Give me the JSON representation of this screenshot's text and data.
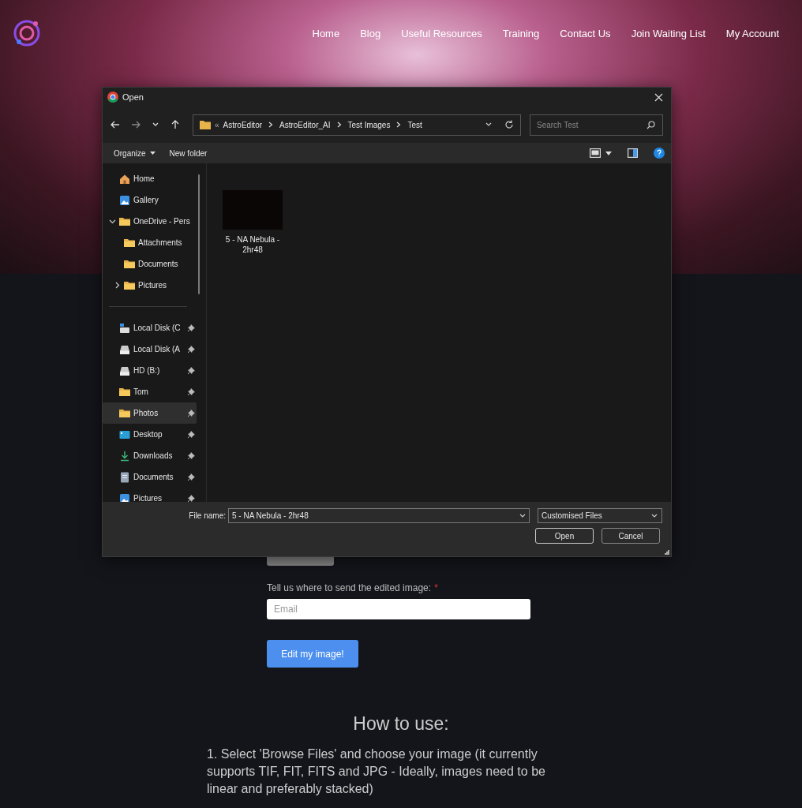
{
  "header": {
    "nav": [
      "Home",
      "Blog",
      "Useful Resources",
      "Training",
      "Contact Us",
      "Join Waiting List",
      "My Account"
    ]
  },
  "form": {
    "email_label": "Tell us where to send the edited image:",
    "required_mark": "*",
    "email": {
      "placeholder": "Email"
    },
    "submit": "Edit my image!"
  },
  "how_to": {
    "title": "How to use:",
    "steps": [
      "1. Select 'Browse Files' and choose your image (it currently supports TIF, FIT, FITS and JPG - Ideally, images need to be linear and preferably stacked)"
    ]
  },
  "dialog": {
    "title": "Open",
    "overflow": "«",
    "breadcrumb": [
      "AstroEditor",
      "AstroEditor_AI",
      "Test Images",
      "Test"
    ],
    "search": {
      "placeholder": "Search Test"
    },
    "commands": [
      {
        "label": "Organize",
        "kind": "menu"
      },
      {
        "label": "New folder",
        "kind": "plain"
      }
    ],
    "tree": [
      {
        "label": "Home",
        "kind": "home"
      },
      {
        "label": "Gallery",
        "kind": "gallery"
      },
      {
        "label": "OneDrive - Pers",
        "kind": "folder",
        "expanded": true,
        "children": [
          {
            "label": "Attachments",
            "kind": "folder"
          },
          {
            "label": "Documents",
            "kind": "folder"
          },
          {
            "label": "Pictures",
            "kind": "folder",
            "expanded": false
          }
        ]
      }
    ],
    "quick_access": [
      {
        "label": "Local Disk (C",
        "kind": "system-drive",
        "pinned": true,
        "selected": false
      },
      {
        "label": "Local Disk (A",
        "kind": "drive",
        "pinned": true,
        "selected": false
      },
      {
        "label": "HD (B:)",
        "kind": "drive",
        "pinned": true,
        "selected": false
      },
      {
        "label": "Tom",
        "kind": "folder",
        "pinned": true,
        "selected": false
      },
      {
        "label": "Photos",
        "kind": "folder",
        "pinned": true,
        "selected": true
      },
      {
        "label": "Desktop",
        "kind": "desktop",
        "pinned": true,
        "selected": false
      },
      {
        "label": "Downloads",
        "kind": "download",
        "pinned": true,
        "selected": false
      },
      {
        "label": "Documents",
        "kind": "document",
        "pinned": true,
        "selected": false
      },
      {
        "label": "Pictures",
        "kind": "picture",
        "pinned": true,
        "selected": false
      }
    ],
    "files": [
      {
        "name": "5 - NA Nebula - 2hr48"
      }
    ],
    "file_name": {
      "label": "File name:",
      "value": "5 - NA Nebula - 2hr48"
    },
    "file_type": "Customised Files",
    "buttons": [
      "Open",
      "Cancel"
    ]
  }
}
